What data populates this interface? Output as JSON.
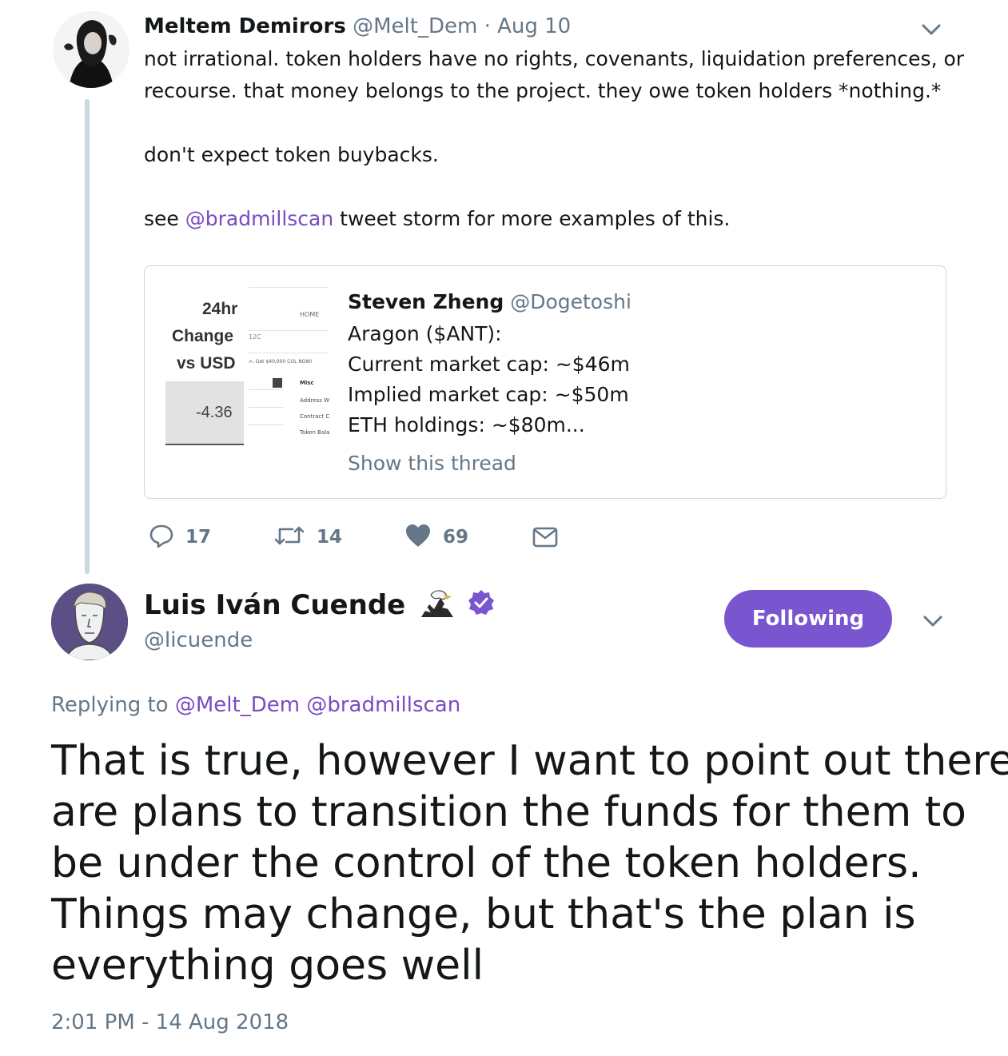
{
  "parent_tweet": {
    "name": "Meltem Demirors",
    "handle": "@Melt_Dem",
    "separator": "·",
    "date": "Aug 10",
    "text_line1": "not irrational. token holders have no rights, covenants, liquidation preferences, or",
    "text_line2": "recourse. that money belongs to the project. they owe token holders *nothing.*",
    "text_line3": "don't expect token buybacks.",
    "text_line4_prefix": "see ",
    "text_line4_mention": "@bradmillscan",
    "text_line4_suffix": " tweet storm for more examples of this.",
    "quoted": {
      "name": "Steven Zheng",
      "handle": "@Dogetoshi",
      "lines": [
        "Aragon ($ANT):",
        "Current market cap: ~$46m",
        "Implied market cap: ~$50m",
        "ETH holdings: ~$80m..."
      ],
      "show_thread": "Show this thread",
      "thumb": {
        "header1": "24hr",
        "header2": "Change",
        "header3": "vs USD",
        "value": "-4.36",
        "home": "HOME",
        "tag": "12C",
        "promo": ">, Get $40,000 COL NOW!",
        "misc": "Misc",
        "address": "Address W",
        "contract": "Contract C",
        "token": "Token Bala"
      }
    },
    "actions": {
      "replies": "17",
      "retweets": "14",
      "likes": "69"
    }
  },
  "reply_tweet": {
    "name": "Luis Iván Cuende",
    "handle": "@licuende",
    "follow_label": "Following",
    "replying_prefix": "Replying to ",
    "replying_to_1": "@Melt_Dem",
    "replying_to_2": "@bradmillscan",
    "text_lines": [
      "That is true, however I want to point out there",
      "are plans to transition the funds for them to",
      "be under the control of the token holders.",
      "Things may change, but that's the plan is",
      "everything goes well"
    ],
    "timestamp": "2:01 PM - 14 Aug 2018"
  },
  "colors": {
    "accent": "#794bc4",
    "button": "#7955cf",
    "grey_text": "#657786",
    "border": "#ccd6dd"
  },
  "icons": [
    "caret-down-icon",
    "reply-icon",
    "retweet-icon",
    "like-icon",
    "direct-message-icon",
    "eagle-emoji-icon",
    "verified-badge-icon"
  ]
}
